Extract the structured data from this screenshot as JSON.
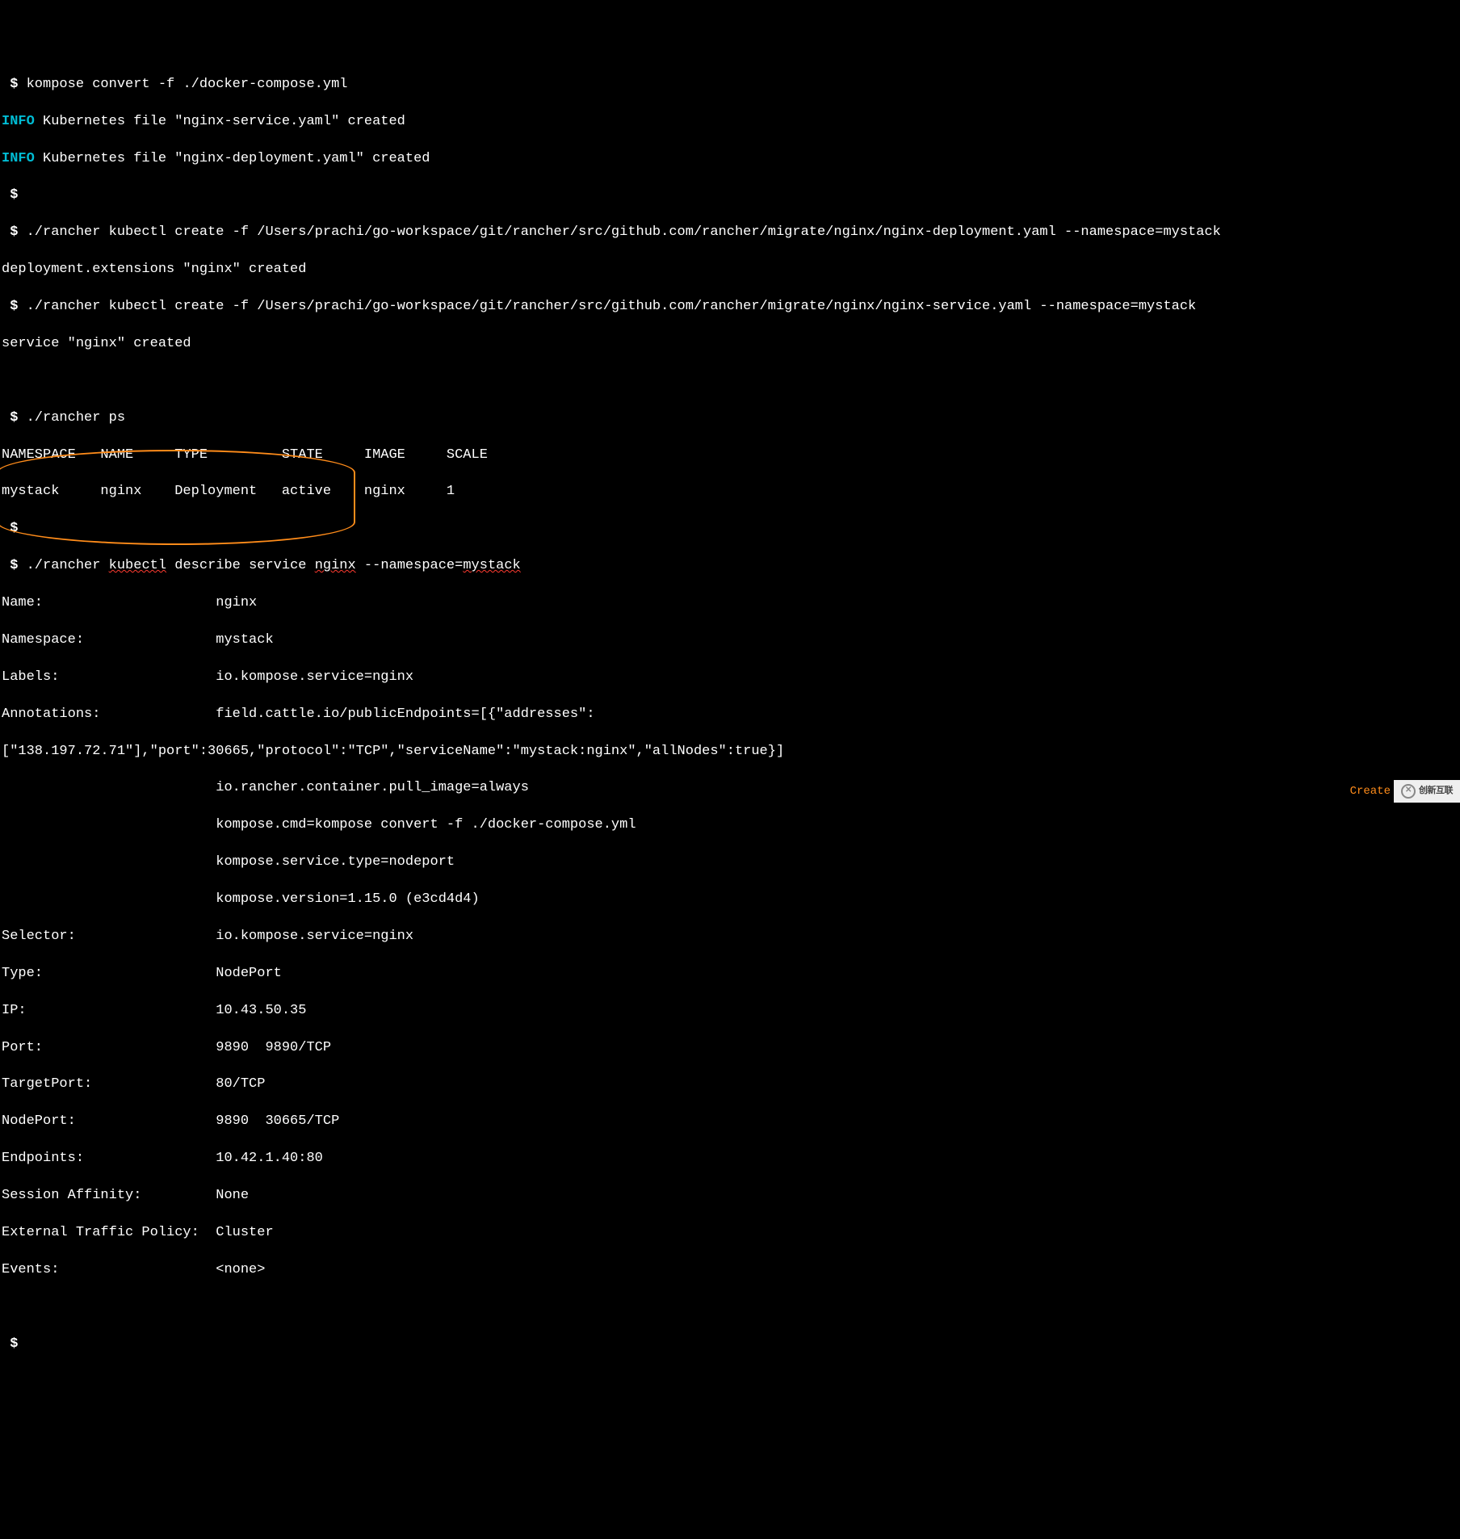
{
  "lines": {
    "l01_prompt": " $ ",
    "l01_cmd": "kompose convert -f ./docker-compose.yml",
    "l02_info": "INFO",
    "l02_rest": " Kubernetes file \"nginx-service.yaml\" created",
    "l03_info": "INFO",
    "l03_rest": " Kubernetes file \"nginx-deployment.yaml\" created",
    "l04_prompt": " $",
    "l05_prompt": " $ ",
    "l05_cmd": "./rancher kubectl create -f /Users/prachi/go-workspace/git/rancher/src/github.com/rancher/migrate/nginx/nginx-deployment.yaml --namespace=mystack",
    "l06": "deployment.extensions \"nginx\" created",
    "l07_prompt": " $ ",
    "l07_cmd": "./rancher kubectl create -f /Users/prachi/go-workspace/git/rancher/src/github.com/rancher/migrate/nginx/nginx-service.yaml --namespace=mystack",
    "l08": "service \"nginx\" created",
    "l09": "",
    "l10_prompt": " $ ",
    "l10_cmd": "./rancher ps",
    "l11": "NAMESPACE   NAME     TYPE         STATE     IMAGE     SCALE",
    "l12": "mystack     nginx    Deployment   active    nginx     1",
    "l13_prompt": " $",
    "l14_prompt": " $ ",
    "l14_cmd_a": "./rancher ",
    "l14_cmd_u1": "kubectl",
    "l14_cmd_b": " describe service ",
    "l14_cmd_u2": "nginx",
    "l14_cmd_c": " --namespace=",
    "l14_cmd_u3": "mystack",
    "l15": "Name:                     nginx",
    "l16": "Namespace:                mystack",
    "l17": "Labels:                   io.kompose.service=nginx",
    "l18": "Annotations:              field.cattle.io/publicEndpoints=[{\"addresses\":",
    "l19": "[\"138.197.72.71\"],\"port\":30665,\"protocol\":\"TCP\",\"serviceName\":\"mystack:nginx\",\"allNodes\":true}]",
    "l20": "                          io.rancher.container.pull_image=always",
    "l21": "                          kompose.cmd=kompose convert -f ./docker-compose.yml",
    "l22": "                          kompose.service.type=nodeport",
    "l23": "                          kompose.version=1.15.0 (e3cd4d4)",
    "l24": "Selector:                 io.kompose.service=nginx",
    "l25": "Type:                     NodePort",
    "l26": "IP:                       10.43.50.35",
    "l27": "Port:                     9890  9890/TCP",
    "l28": "TargetPort:               80/TCP",
    "l29": "NodePort:                 9890  30665/TCP",
    "l30": "Endpoints:                10.42.1.40:80",
    "l31": "Session Affinity:         None",
    "l32": "External Traffic Policy:  Cluster",
    "l33": "Events:                   <none>",
    "l34": "",
    "l35_prompt": " $"
  },
  "footer": {
    "create": "Create",
    "logo": "创新互联"
  }
}
